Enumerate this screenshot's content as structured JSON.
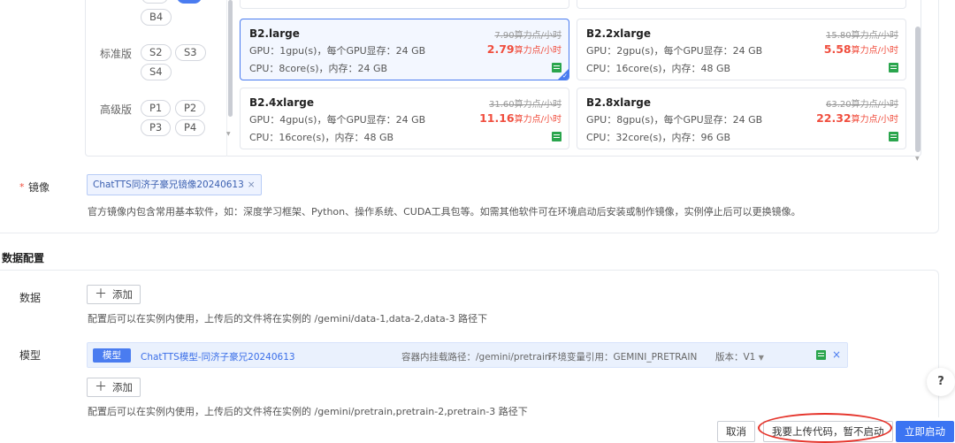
{
  "instance_spec": {
    "tiers": [
      {
        "label": "",
        "chips": [
          "B4"
        ]
      },
      {
        "label": "标准版",
        "chips": [
          "S2",
          "S3",
          "S4"
        ]
      },
      {
        "label": "高级版",
        "chips": [
          "P1",
          "P2",
          "P3",
          "P4"
        ]
      }
    ],
    "cards": [
      {
        "name": "B2.large",
        "gpu": "GPU：1gpu(s)，每个GPU显存：24 GB",
        "cpu": "CPU：8core(s)，内存：24 GB",
        "old_price": "7.90算力点/小时",
        "new_price": "2.79",
        "new_unit": "算力点/小时",
        "selected": true
      },
      {
        "name": "B2.2xlarge",
        "gpu": "GPU：2gpu(s)，每个GPU显存：24 GB",
        "cpu": "CPU：16core(s)，内存：48 GB",
        "old_price": "15.80算力点/小时",
        "new_price": "5.58",
        "new_unit": "算力点/小时",
        "selected": false
      },
      {
        "name": "B2.4xlarge",
        "gpu": "GPU：4gpu(s)，每个GPU显存：24 GB",
        "cpu": "CPU：16core(s)，内存：48 GB",
        "old_price": "31.60算力点/小时",
        "new_price": "11.16",
        "new_unit": "算力点/小时",
        "selected": false
      },
      {
        "name": "B2.8xlarge",
        "gpu": "GPU：8gpu(s)，每个GPU显存：24 GB",
        "cpu": "CPU：32core(s)，内存：96 GB",
        "old_price": "63.20算力点/小时",
        "new_price": "22.32",
        "new_unit": "算力点/小时",
        "selected": false
      }
    ]
  },
  "image": {
    "label": "镜像",
    "selected_tag": "ChatTTS同济子豪兄镜像20240613",
    "tag_close": "×",
    "hint": "官方镜像内包含常用基本软件，如：深度学习框架、Python、操作系统、CUDA工具包等。如需其他软件可在环境启动后安装或制作镜像，实例停止后可以更换镜像。"
  },
  "data_config": {
    "title": "数据配置",
    "data": {
      "label": "数据",
      "add_label": "添加",
      "hint": "配置后可以在实例内使用，上传后的文件将在实例的 /gemini/data-1,data-2,data-3 路径下"
    },
    "model": {
      "label": "模型",
      "badge": "模型",
      "name": "ChatTTS模型-同济子豪兄20240613",
      "mount_path": "容器内挂载路径：/gemini/pretrain",
      "env_var": "环境变量引用：GEMINI_PRETRAIN",
      "version": "版本：V1",
      "close": "×",
      "add_label": "添加",
      "hint": "配置后可以在实例内使用，上传后的文件将在实例的 /gemini/pretrain,pretrain-2,pretrain-3 路径下"
    }
  },
  "footer": {
    "cancel": "取消",
    "upload_code": "我要上传代码，暂不启动",
    "start_now": "立即启动"
  },
  "help": "?",
  "colors": {
    "primary": "#3b74f2",
    "price_red": "#f04e3e",
    "annotation_red": "#e5332a"
  }
}
